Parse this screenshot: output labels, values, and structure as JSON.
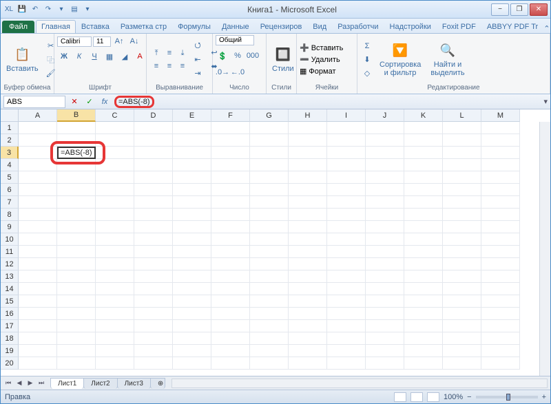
{
  "title": "Книга1 - Microsoft Excel",
  "qat": [
    "XL",
    "💾",
    "↶",
    "↷",
    "▾",
    "▤",
    "▾"
  ],
  "tabs": {
    "file": "Файл",
    "items": [
      "Главная",
      "Вставка",
      "Разметка стр",
      "Формулы",
      "Данные",
      "Рецензиров",
      "Вид",
      "Разработчи",
      "Надстройки",
      "Foxit PDF",
      "ABBYY PDF Tr"
    ]
  },
  "ribbon_help": "?",
  "groups": {
    "clipboard": {
      "label": "Буфер обмена",
      "paste": "Вставить"
    },
    "font": {
      "label": "Шрифт",
      "name": "Calibri",
      "size": "11",
      "bold": "Ж",
      "italic": "К",
      "underline": "Ч"
    },
    "align": {
      "label": "Выравнивание"
    },
    "number": {
      "label": "Число",
      "format": "Общий"
    },
    "styles": {
      "label": "Стили",
      "btn": "Стили"
    },
    "cells": {
      "label": "Ячейки",
      "insert": "Вставить",
      "delete": "Удалить",
      "format": "Формат"
    },
    "edit": {
      "label": "Редактирование",
      "sort": "Сортировка и фильтр",
      "find": "Найти и выделить"
    }
  },
  "formula_bar": {
    "name": "ABS",
    "cancel": "✕",
    "enter": "✓",
    "fx": "fx",
    "value": "=ABS(-8)"
  },
  "columns": [
    "A",
    "B",
    "C",
    "D",
    "E",
    "F",
    "G",
    "H",
    "I",
    "J",
    "K",
    "L",
    "M"
  ],
  "rows": [
    "1",
    "2",
    "3",
    "4",
    "5",
    "6",
    "7",
    "8",
    "9",
    "10",
    "11",
    "12",
    "13",
    "14",
    "15",
    "16",
    "17",
    "18",
    "19",
    "20"
  ],
  "active": {
    "ref": "B3",
    "value": "=ABS(-8)"
  },
  "sheets": {
    "nav": [
      "⏮",
      "◀",
      "▶",
      "⏭"
    ],
    "tabs": [
      "Лист1",
      "Лист2",
      "Лист3"
    ]
  },
  "status": {
    "left": "Правка",
    "zoom": "100%",
    "minus": "−",
    "plus": "+"
  }
}
